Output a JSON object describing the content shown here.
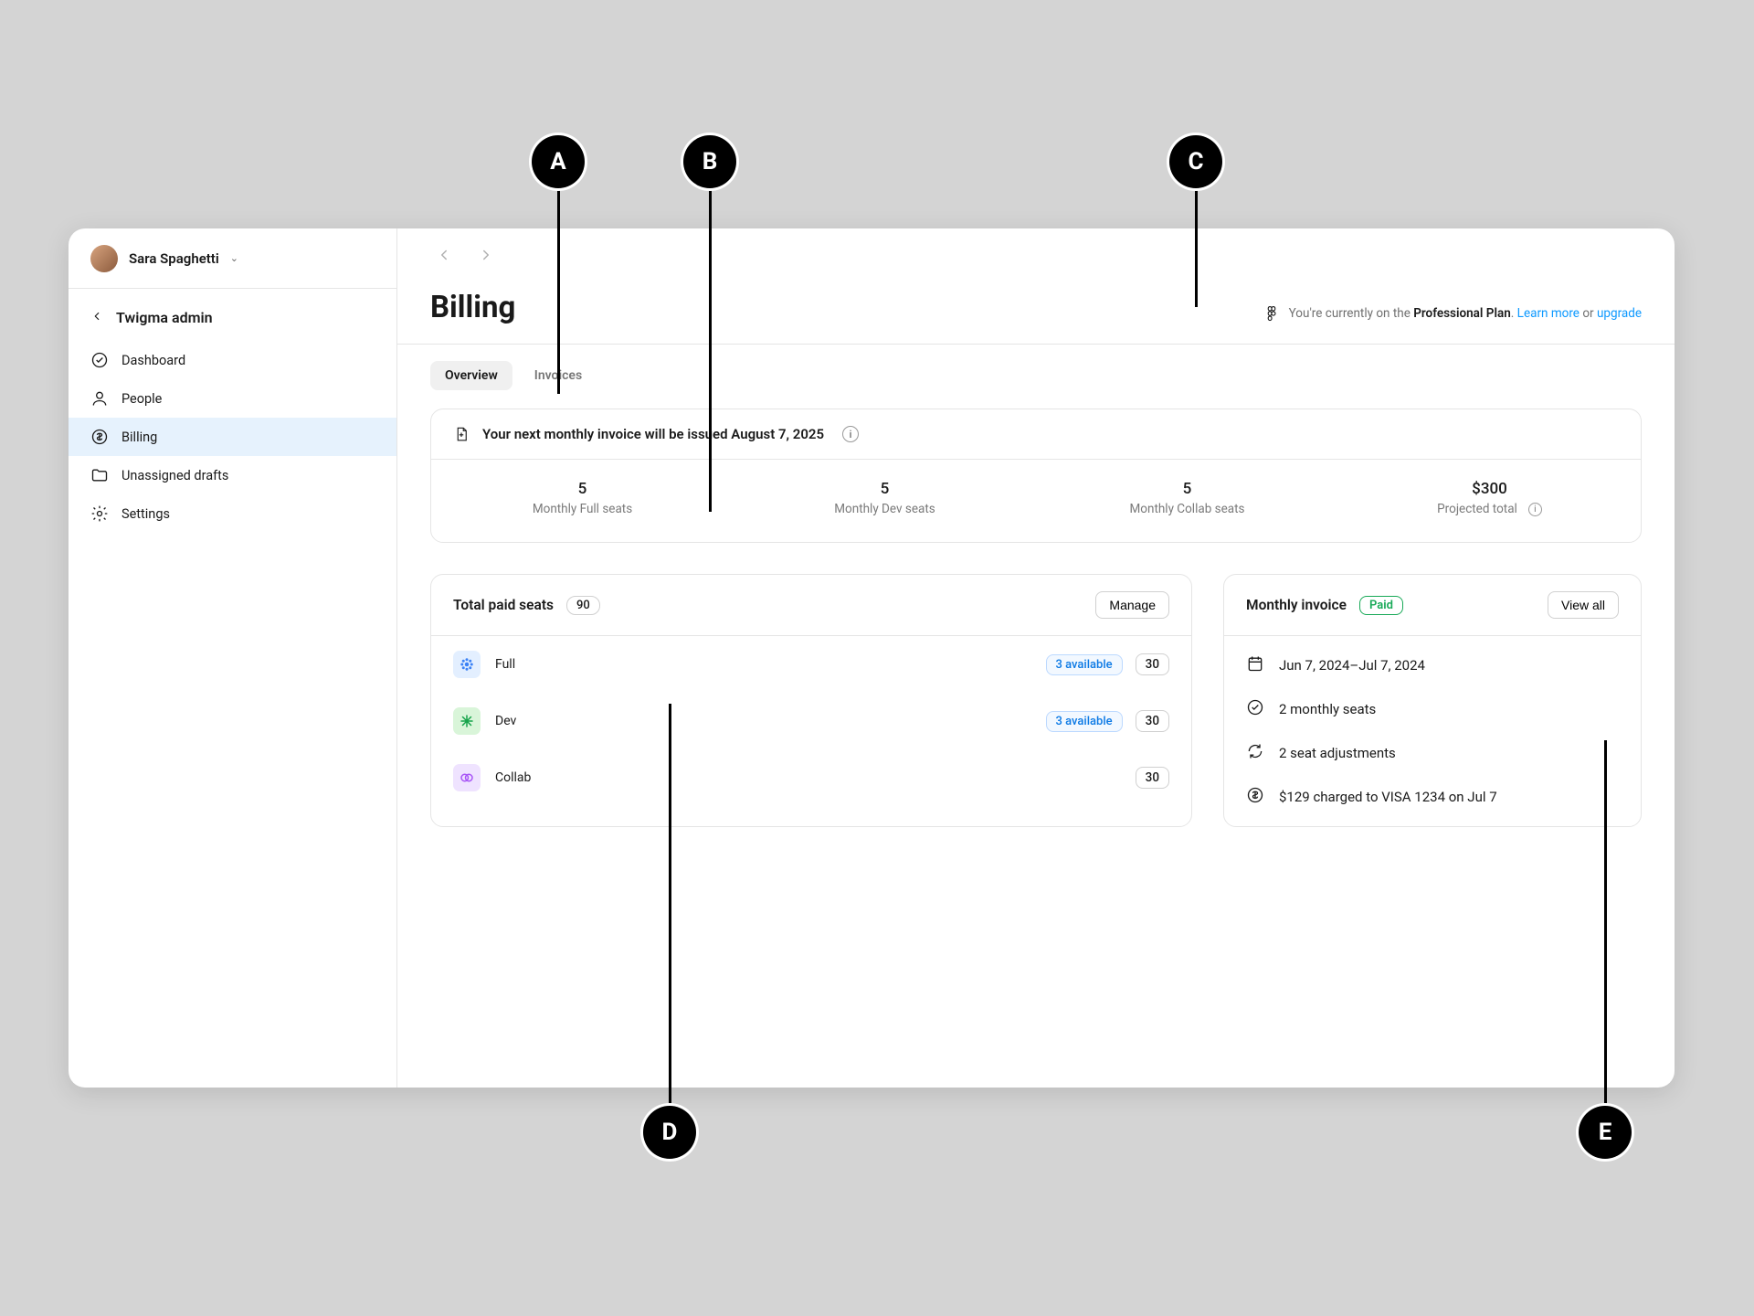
{
  "user": {
    "name": "Sara Spaghetti"
  },
  "sidebar": {
    "back_label": "Twigma admin",
    "items": [
      {
        "label": "Dashboard"
      },
      {
        "label": "People"
      },
      {
        "label": "Billing"
      },
      {
        "label": "Unassigned drafts"
      },
      {
        "label": "Settings"
      }
    ]
  },
  "header": {
    "title": "Billing",
    "plan_prefix": "You're currently on the ",
    "plan_name": "Professional Plan",
    "plan_sep": ". ",
    "learn_more": "Learn more",
    "or": " or ",
    "upgrade": "upgrade"
  },
  "tabs": {
    "overview": "Overview",
    "invoices": "Invoices"
  },
  "summary": {
    "banner": "Your next monthly invoice will be issued August 7, 2025",
    "stats": [
      {
        "value": "5",
        "label": "Monthly Full seats"
      },
      {
        "value": "5",
        "label": "Monthly Dev seats"
      },
      {
        "value": "5",
        "label": "Monthly Collab seats"
      },
      {
        "value": "$300",
        "label": "Projected total"
      }
    ]
  },
  "seats_card": {
    "title": "Total paid seats",
    "total": "90",
    "manage": "Manage",
    "rows": [
      {
        "name": "Full",
        "available": "3 available",
        "count": "30"
      },
      {
        "name": "Dev",
        "available": "3 available",
        "count": "30"
      },
      {
        "name": "Collab",
        "available": "",
        "count": "30"
      }
    ]
  },
  "invoice_card": {
    "title": "Monthly invoice",
    "status": "Paid",
    "view_all": "View all",
    "lines": {
      "date": "Jun 7, 2024–Jul 7, 2024",
      "seats": "2 monthly seats",
      "adjustments": "2 seat adjustments",
      "charge": "$129 charged to VISA 1234 on Jul 7"
    }
  },
  "annotations": {
    "a": "A",
    "b": "B",
    "c": "C",
    "d": "D",
    "e": "E"
  }
}
